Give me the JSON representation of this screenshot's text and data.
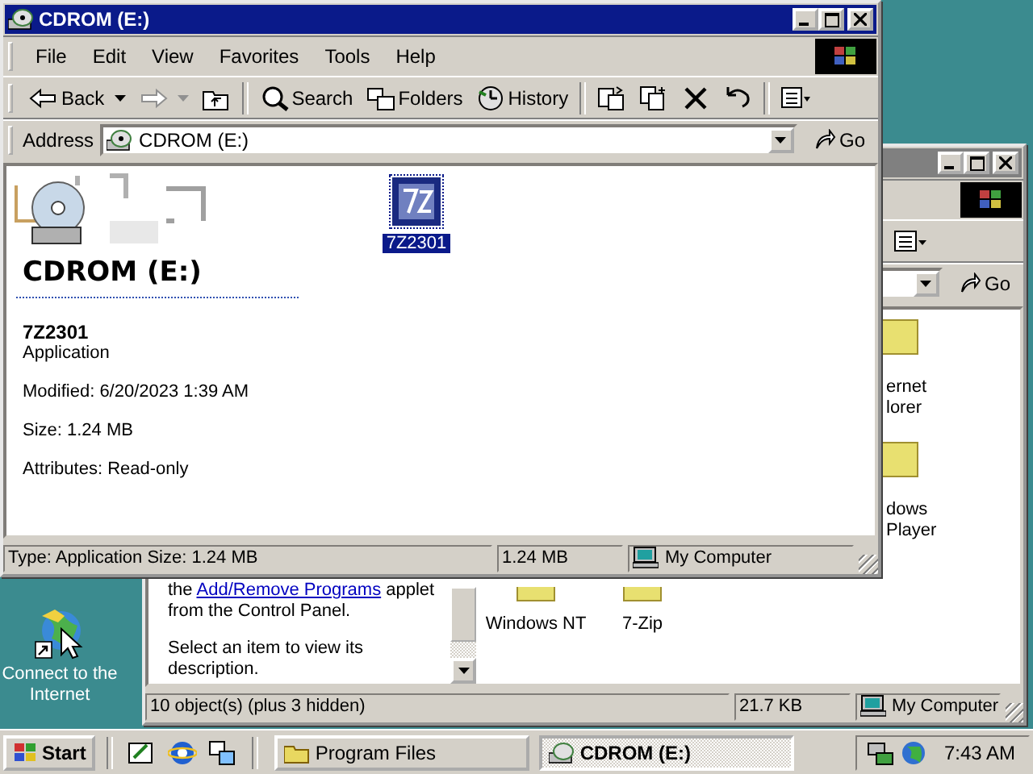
{
  "desktop_icons": [
    {
      "label": "Connect to the Internet"
    }
  ],
  "back_window": {
    "items": [
      {
        "label": "ernet lorer"
      },
      {
        "label": "dows Player"
      },
      {
        "label": "Windows NT"
      },
      {
        "label": "7-Zip"
      }
    ],
    "info": {
      "before": "the ",
      "link": "Add/Remove Programs",
      "after": " applet from the Control Panel.",
      "hint": "Select an item to view its description."
    },
    "address": {
      "go": "Go"
    },
    "status_bar": [
      "10 object(s) (plus 3 hidden)",
      "21.7 KB",
      "My Computer"
    ]
  },
  "window": {
    "title": "CDROM (E:)",
    "menu": [
      "File",
      "Edit",
      "View",
      "Favorites",
      "Tools",
      "Help"
    ],
    "toolbar": [
      {
        "kind": "back",
        "label": "Back",
        "disabled": false
      },
      {
        "kind": "forward",
        "disabled": true
      },
      {
        "kind": "up",
        "disabled": false
      },
      {
        "kind": "search",
        "label": "Search",
        "disabled": false
      },
      {
        "kind": "folders",
        "label": "Folders",
        "disabled": false
      },
      {
        "kind": "history",
        "label": "History",
        "disabled": false
      },
      {
        "kind": "move",
        "disabled": false
      },
      {
        "kind": "copy",
        "disabled": false
      },
      {
        "kind": "delete",
        "disabled": false
      },
      {
        "kind": "undo",
        "disabled": false
      },
      {
        "kind": "views",
        "disabled": false
      }
    ],
    "address": {
      "label": "Address",
      "value": "CDROM (E:)",
      "go": "Go"
    },
    "heading": "CDROM (E:)",
    "details": {
      "name": "7Z2301",
      "type": "Application",
      "lines": [
        "Modified: 6/20/2023 1:39 AM",
        "Size: 1.24 MB",
        "Attributes: Read-only"
      ]
    },
    "files": [
      {
        "label": "7Z2301",
        "selected": true
      }
    ],
    "status_bar": [
      "Type: Application Size: 1.24 MB",
      "1.24 MB",
      "My Computer"
    ]
  },
  "taskbar": {
    "start": "Start",
    "buttons": [
      {
        "label": "Program Files",
        "selected": false
      },
      {
        "label": "CDROM (E:)",
        "selected": true
      }
    ],
    "clock": "7:43 AM"
  }
}
